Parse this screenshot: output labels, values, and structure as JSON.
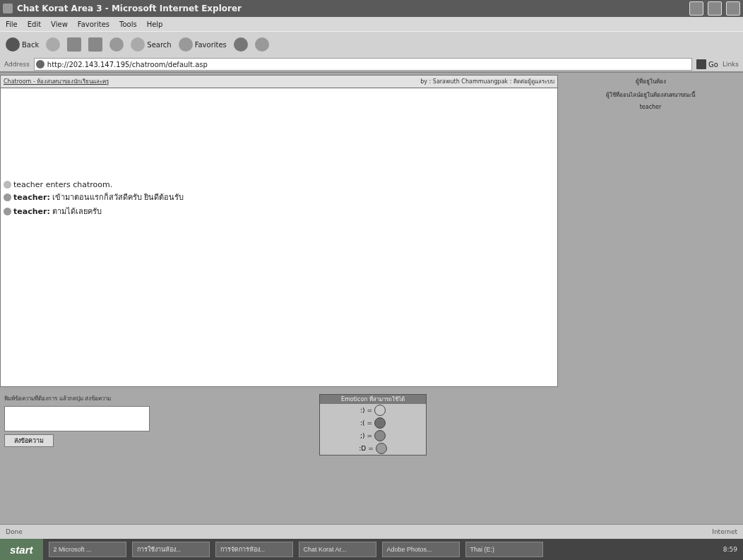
{
  "window": {
    "title": "Chat Korat Area 3 - Microsoft Internet Explorer"
  },
  "menu": [
    "File",
    "Edit",
    "View",
    "Favorites",
    "Tools",
    "Help"
  ],
  "toolbar": {
    "back": "Back",
    "search": "Search",
    "favorites": "Favorites"
  },
  "address": {
    "label": "Address",
    "url": "http://202.143.147.195/chatroom/default.asp",
    "go": "Go",
    "links": "Links"
  },
  "chat": {
    "header_left": "Chatroom - ห้องสนทนาของนักเรียนและครู",
    "header_right": "by : Sarawuth Chammuangpak : ติดต่อผู้ดูแลระบบ",
    "messages": [
      {
        "kind": "event",
        "text": "teacher enters chatroom."
      },
      {
        "kind": "message",
        "user": "teacher:",
        "text": "เข้ามาตอนแรกก็สวัสดีครับ ยินดีต้อนรับ"
      },
      {
        "kind": "message",
        "user": "teacher:",
        "text": "ตามได้เลยครับ"
      }
    ]
  },
  "compose": {
    "label": "พิมพ์ข้อความที่ต้องการ แล้วกดปุ่ม ส่งข้อความ",
    "button": "ส่งข้อความ"
  },
  "emoticons": {
    "title": "Emoticon ที่สามารถใช้ได้",
    "items": [
      {
        "code": ":) =",
        "color": "#c8c8c8"
      },
      {
        "code": ":( =",
        "color": "#707070"
      },
      {
        "code": ";) =",
        "color": "#8a8a8a"
      },
      {
        "code": ":D =",
        "color": "#9c9c9c"
      }
    ]
  },
  "online": {
    "title": "ผู้ที่อยู่ในห้อง",
    "note": "ผู้ใช้ที่ออนไลน์อยู่ในห้องสนทนาขณะนี้",
    "users": [
      "teacher"
    ]
  },
  "status_bar": {
    "left": "Done",
    "right": "Internet"
  },
  "taskbar": {
    "start": "start",
    "items": [
      "2 Microsoft ...",
      "การใช้งานห้อง...",
      "การจัดการห้อง...",
      "Chat Korat Ar...",
      "Adobe Photos...",
      "Thai (E:)"
    ],
    "clock": "8:59"
  }
}
